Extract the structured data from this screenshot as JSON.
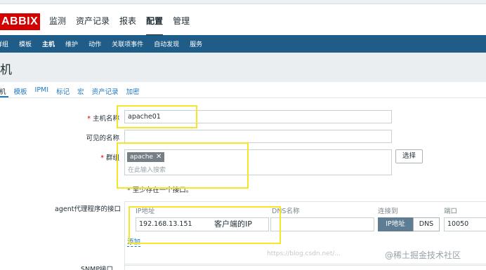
{
  "header": {
    "logo_text": "ABBIX",
    "nav": [
      "监测",
      "资产记录",
      "报表",
      "配置",
      "管理"
    ],
    "active_nav": "配置"
  },
  "subnav": [
    "群组",
    "模板",
    "主机",
    "维护",
    "动作",
    "关联项事件",
    "自动发现",
    "服务"
  ],
  "page_title": "机",
  "tabs": [
    "机",
    "模板",
    "IPMI",
    "标记",
    "宏",
    "资产记录",
    "加密"
  ],
  "form": {
    "hostname_label": "主机名称",
    "hostname_value": "apache01",
    "visible_name_label": "可见的名称",
    "visible_name_value": "",
    "groups_label": "群组",
    "group_chip": "apache",
    "groups_placeholder": "在此输入搜索",
    "select_button": "选择",
    "hint": "* 至少存在一个接口。",
    "interfaces_label": "agent代理程序的接口",
    "iface_headers": {
      "ip": "IP地址",
      "dns": "DNS名称",
      "connect": "连接到",
      "port": "端口"
    },
    "ip_value": "192.168.13.151",
    "port_value": "10050",
    "connect_ip": "IP地址",
    "connect_dns": "DNS",
    "add_link": "添加",
    "snmp_label": "SNMP接口"
  },
  "annotation": "客户端的IP",
  "watermarks": {
    "csdn": "https://blog.csdn.net/...",
    "juejin": "@稀土掘金技术社区"
  },
  "colors": {
    "brand_red": "#d40000",
    "subnav_blue": "#1f5c88",
    "highlight_yellow": "#f5e62a",
    "link_blue": "#1f78c1"
  }
}
